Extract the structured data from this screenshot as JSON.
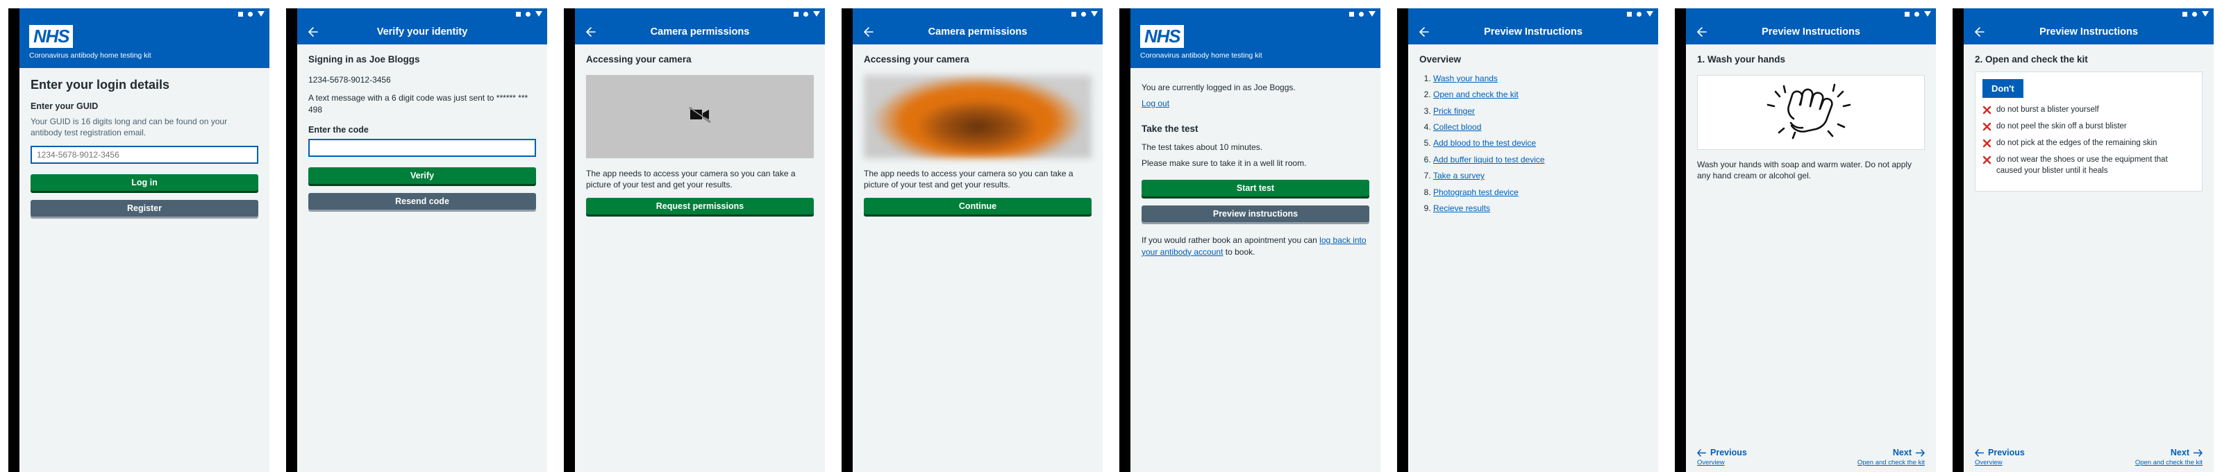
{
  "app": {
    "brand_logo": "NHS",
    "brand_subtitle": "Coronavirus antibody home testing kit",
    "accent_blue": "#005eb8",
    "button_green": "#007f3b",
    "button_grey": "#4c6272",
    "link_blue": "#005eb8",
    "error_red": "#d5281b",
    "page_bg": "#f0f4f5",
    "statusbar_icons": [
      "square-icon",
      "circle-icon",
      "triangle-down-icon"
    ],
    "back_icon": "back-arrow-icon"
  },
  "screens": [
    {
      "id": "login",
      "header_type": "brand",
      "title": "Enter your login details",
      "field_label": "Enter your GUID",
      "field_hint": "Your GUID is 16 digits long and can be found on your antibody test registration email.",
      "input_placeholder": "1234-5678-9012-3456",
      "input_value": "",
      "primary_button": "Log in",
      "secondary_button": "Register"
    },
    {
      "id": "verify-identity",
      "header_type": "nav",
      "nav_title": "Verify your identity",
      "heading": "Signing in as Joe Bloggs",
      "guid": "1234-5678-9012-3456",
      "sms_note": "A text message with a 6 digit code was just sent to ****** *** 498",
      "field_label": "Enter the code",
      "input_placeholder": "",
      "input_value": "",
      "primary_button": "Verify",
      "secondary_button": "Resend code"
    },
    {
      "id": "camera-permissions-denied",
      "header_type": "nav",
      "nav_title": "Camera permissions",
      "heading": "Accessing your camera",
      "preview_state": "camera-off-icon",
      "body_text": "The app needs to access your camera so you can take a picture of your test and get your results.",
      "primary_button": "Request permissions"
    },
    {
      "id": "camera-permissions-granted",
      "header_type": "nav",
      "nav_title": "Camera permissions",
      "heading": "Accessing your camera",
      "preview_state": "blurred-camera-feed",
      "body_text": "The app needs to access your camera so you can take a picture of your test and get your results.",
      "primary_button": "Continue"
    },
    {
      "id": "take-the-test",
      "header_type": "brand",
      "logged_in_text": "You are currently logged in as Joe Boggs.",
      "logout_link": "Log out",
      "heading": "Take the test",
      "duration_text": "The test takes about 10 minutes.",
      "lighting_text": "Please make sure to take it in a well lit room.",
      "primary_button": "Start test",
      "secondary_button": "Preview instructions",
      "booking_prefix": "If you would rather book an apointment you can ",
      "booking_link": "log back into your antibody account",
      "booking_suffix": " to book."
    },
    {
      "id": "preview-overview",
      "header_type": "nav",
      "nav_title": "Preview Instructions",
      "heading": "Overview",
      "steps": [
        "Wash your hands",
        "Open and check the kit",
        "Prick finger",
        "Collect blood",
        "Add blood to the test device",
        "Add buffer liquid to test device",
        "Take a survey",
        "Photograph test device",
        "Recieve results"
      ]
    },
    {
      "id": "preview-step-1",
      "header_type": "nav",
      "nav_title": "Preview Instructions",
      "heading": "1. Wash your hands",
      "illustration": "washing-hands-icon",
      "body_text": "Wash your hands with soap and warm water. Do not apply any hand cream or alcohol gel.",
      "pager": {
        "prev_label": "Previous",
        "prev_sub": "Overview",
        "next_label": "Next",
        "next_sub": "Open and check the kit"
      }
    },
    {
      "id": "preview-step-2",
      "header_type": "nav",
      "nav_title": "Preview Instructions",
      "heading": "2. Open and check the kit",
      "dont_badge": "Don't",
      "dont_items": [
        "do not burst a blister yourself",
        "do not peel the skin off a burst blister",
        "do not pick at the edges of the remaining skin",
        "do not wear the shoes or use the equipment that caused your blister until it heals"
      ],
      "pager": {
        "prev_label": "Previous",
        "prev_sub": "Overview",
        "next_label": "Next",
        "next_sub": "Open and check the kit"
      }
    }
  ]
}
